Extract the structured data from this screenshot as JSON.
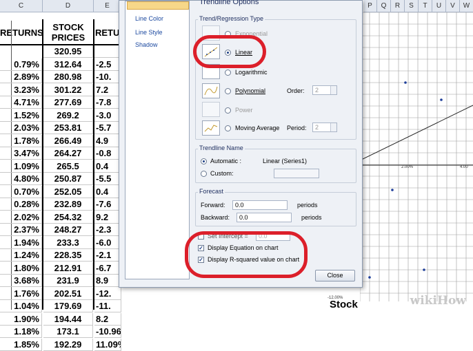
{
  "sheet": {
    "col_headers": [
      "C",
      "D",
      "E"
    ],
    "right_col_headers": [
      "P",
      "Q",
      "R",
      "S",
      "T",
      "U",
      "V",
      "W"
    ],
    "header_c": "RETURNS",
    "header_d": "STOCK PRICES",
    "header_e": "RETU",
    "c_values": [
      "0.79%",
      "2.89%",
      "3.23%",
      "4.71%",
      "1.52%",
      "2.03%",
      "1.78%",
      "3.47%",
      "1.09%",
      "4.80%",
      "0.70%",
      "0.28%",
      "2.02%",
      "2.37%",
      "1.94%",
      "1.24%",
      "1.80%",
      "3.68%",
      "1.76%",
      "1.04%",
      "1.90%",
      "1.18%",
      "1.85%"
    ],
    "d_values": [
      "320.95",
      "312.64",
      "280.98",
      "301.22",
      "277.69",
      "269.2",
      "253.81",
      "266.49",
      "264.27",
      "265.5",
      "250.87",
      "252.05",
      "232.89",
      "254.32",
      "248.27",
      "233.3",
      "228.35",
      "212.91",
      "231.9",
      "202.51",
      "179.69",
      "194.44",
      "173.1",
      "192.29"
    ],
    "e_values": [
      "",
      "-2.5",
      "-10.",
      "7.2",
      "-7.8",
      "-3.0",
      "-5.7",
      "4.9",
      "-0.8",
      "0.4",
      "-5.5",
      "0.4",
      "-7.6",
      "9.2",
      "-2.3",
      "-6.0",
      "-2.1",
      "-6.7",
      "8.9",
      "-12.",
      "-11.",
      "8.2",
      "-10.96%",
      "11.09%"
    ]
  },
  "chart": {
    "title": "Stock",
    "x_tick_labels": [
      "2.00%",
      "4.00"
    ],
    "bottom_tick_label": "-12.00%"
  },
  "dialog": {
    "nav_items": [
      "Line Color",
      "Line Style",
      "Shadow"
    ],
    "section_title": "Trendline Options",
    "trend_group_title": "Trend/Regression Type",
    "types": [
      {
        "label": "Exponential",
        "selected": false,
        "disabled": true
      },
      {
        "label": "Linear",
        "selected": true,
        "disabled": false
      },
      {
        "label": "Logarithmic",
        "selected": false,
        "disabled": false
      },
      {
        "label": "Polynomial",
        "selected": false,
        "disabled": false
      },
      {
        "label": "Power",
        "selected": false,
        "disabled": true
      },
      {
        "label": "Moving Average",
        "selected": false,
        "disabled": false
      }
    ],
    "order_label": "Order:",
    "order_value": "2",
    "period_label": "Period:",
    "period_value": "2",
    "name_group_title": "Trendline Name",
    "automatic_label": "Automatic :",
    "automatic_value": "Linear (Series1)",
    "custom_label": "Custom:",
    "forecast_group_title": "Forecast",
    "forward_label": "Forward:",
    "forward_value": "0.0",
    "backward_label": "Backward:",
    "backward_value": "0.0",
    "periods_label": "periods",
    "intercept_label": "Set Intercept =",
    "intercept_value": "0.0",
    "display_equation_label": "Display Equation on chart",
    "display_equation_checked": true,
    "display_r2_label": "Display R-squared value on chart",
    "display_r2_checked": true,
    "close_label": "Close"
  },
  "watermark": "wikiHow",
  "colors": {
    "highlight": "#dc1f2a",
    "dialog_bg": "#eef1f6",
    "nav_link": "#1d4aa0"
  }
}
